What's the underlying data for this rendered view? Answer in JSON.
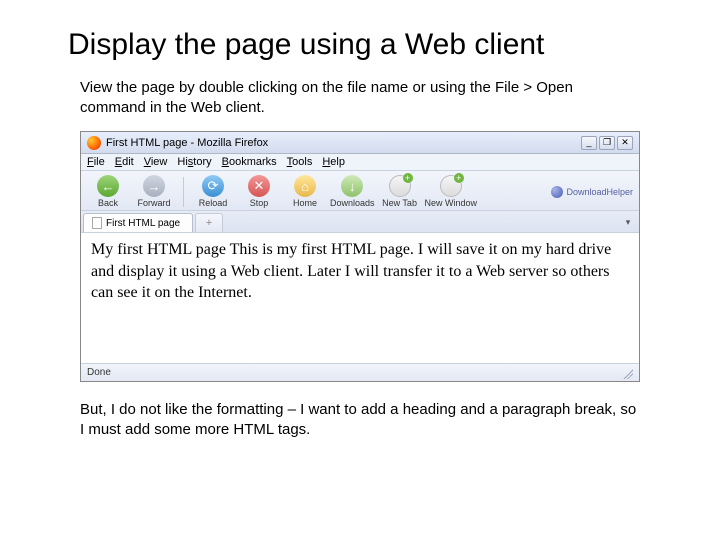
{
  "title": "Display the page using a Web client",
  "intro": "View the page by double clicking on the file name or using the File > Open command in the Web client.",
  "outro": "But, I do not like the formatting – I want to add a heading and a paragraph break, so I must add some more HTML tags.",
  "browser": {
    "titlebar": "First HTML page - Mozilla Firefox",
    "menus": {
      "file": "File",
      "edit": "Edit",
      "view": "View",
      "history": "History",
      "bookmarks": "Bookmarks",
      "tools": "Tools",
      "help": "Help"
    },
    "toolbar": {
      "back": "Back",
      "forward": "Forward",
      "reload": "Reload",
      "stop": "Stop",
      "home": "Home",
      "downloads": "Downloads",
      "newtab": "New Tab",
      "newwindow": "New Window",
      "dlhelper": "DownloadHelper"
    },
    "tab_label": "First HTML page",
    "newtab_glyph": "+",
    "page_text": "My first HTML page This is my first HTML page. I will save it on my hard drive and display it using a Web client. Later I will transfer it to a Web server so others can see it on the Internet.",
    "status": "Done"
  },
  "win_controls": {
    "min": "_",
    "max": "❐",
    "close": "✕"
  },
  "glyphs": {
    "back": "←",
    "fwd": "→",
    "reload": "⟳",
    "stop": "✕",
    "home": "⌂",
    "dl": "↓",
    "dropdown": "▾"
  }
}
